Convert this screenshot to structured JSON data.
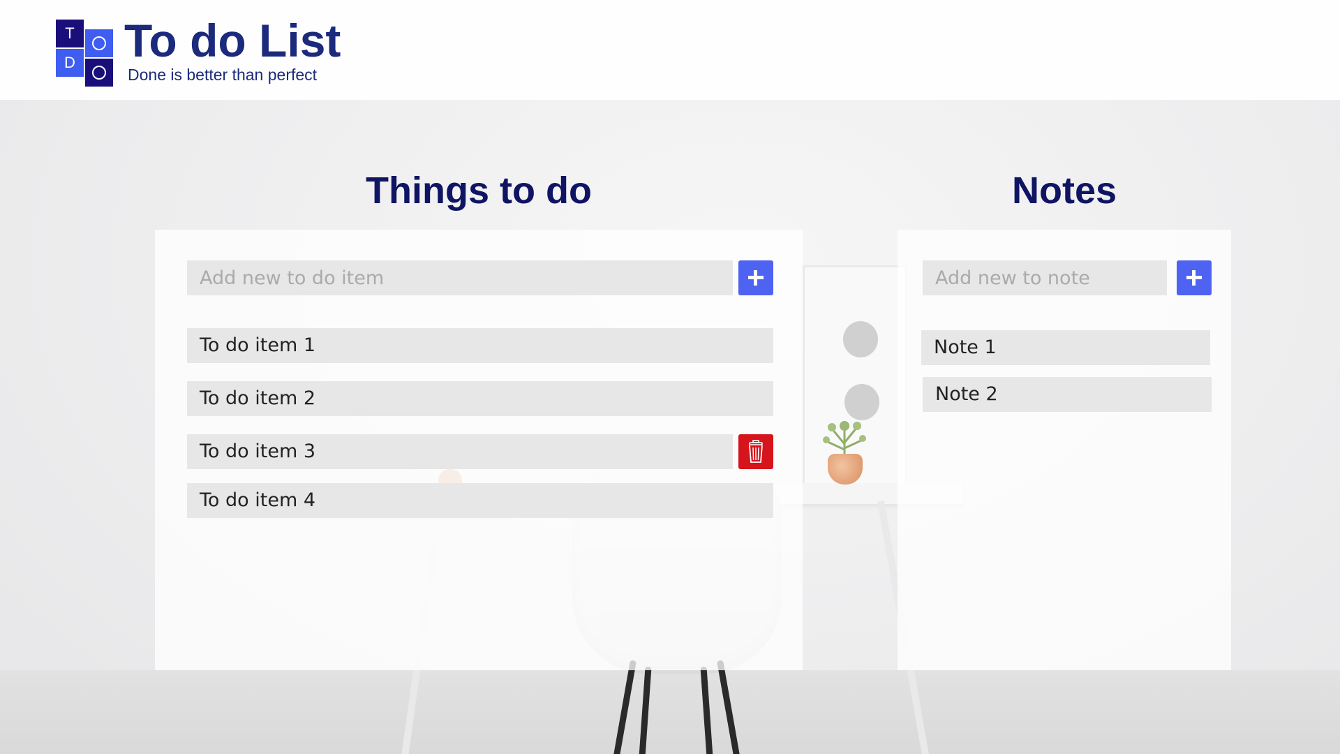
{
  "app": {
    "title": "To do List",
    "subtitle": "Done is better than perfect",
    "logo_letters": [
      "T",
      "D"
    ]
  },
  "todo_section": {
    "title": "Things to do",
    "input_placeholder": "Add new to do item",
    "add_icon": "plus-icon",
    "items": [
      {
        "label": "To do item 1"
      },
      {
        "label": "To do item 2"
      },
      {
        "label": "To do item 3",
        "hovered": true
      },
      {
        "label": "To do item 4"
      }
    ],
    "delete_icon": "trash-icon"
  },
  "notes_section": {
    "title": "Notes",
    "input_placeholder": "Add new to note",
    "add_icon": "plus-icon",
    "items": [
      {
        "label": "Note 1"
      },
      {
        "label": "Note 2"
      }
    ]
  },
  "colors": {
    "accent": "#4f63f2",
    "danger": "#d5141c",
    "heading": "#0f1463",
    "brand": "#1b2a7c",
    "logo_dark": "#1a0f7a",
    "logo_blue": "#3f5df0"
  }
}
